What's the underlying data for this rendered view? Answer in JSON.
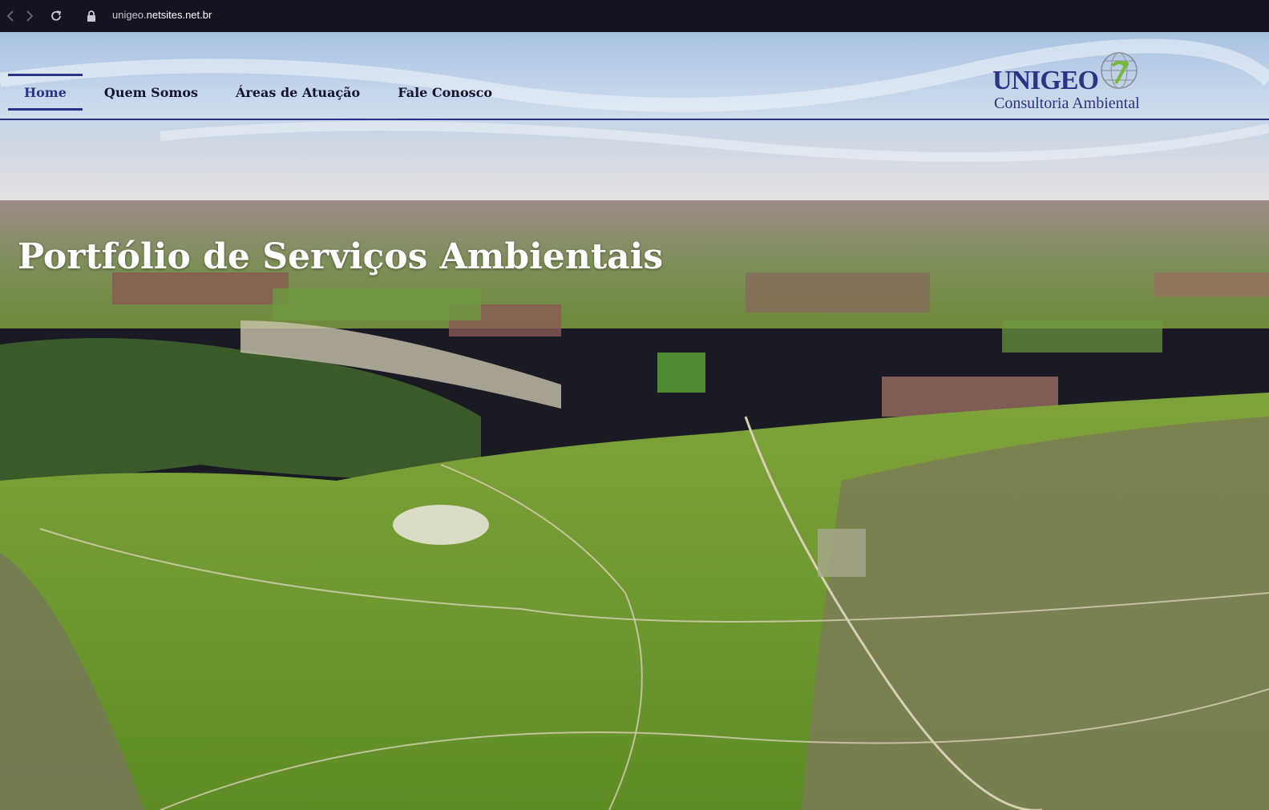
{
  "browser": {
    "url_prefix": "unigeo.",
    "url_host": "netsites.net.br",
    "icons": [
      "back-icon",
      "forward-icon",
      "reload-icon",
      "lock-icon"
    ]
  },
  "header": {
    "nav": [
      {
        "label": "Home",
        "active": true
      },
      {
        "label": "Quem Somos",
        "active": false
      },
      {
        "label": "Áreas de Atuação",
        "active": false
      },
      {
        "label": "Fale Conosco",
        "active": false
      }
    ],
    "logo": {
      "name": "UNIGEO",
      "tagline": "Consultoria Ambiental"
    }
  },
  "hero": {
    "title": "Portfólio de Serviços Ambientais"
  },
  "colors": {
    "brand": "#2a3486",
    "browser_bg": "#14131f"
  }
}
